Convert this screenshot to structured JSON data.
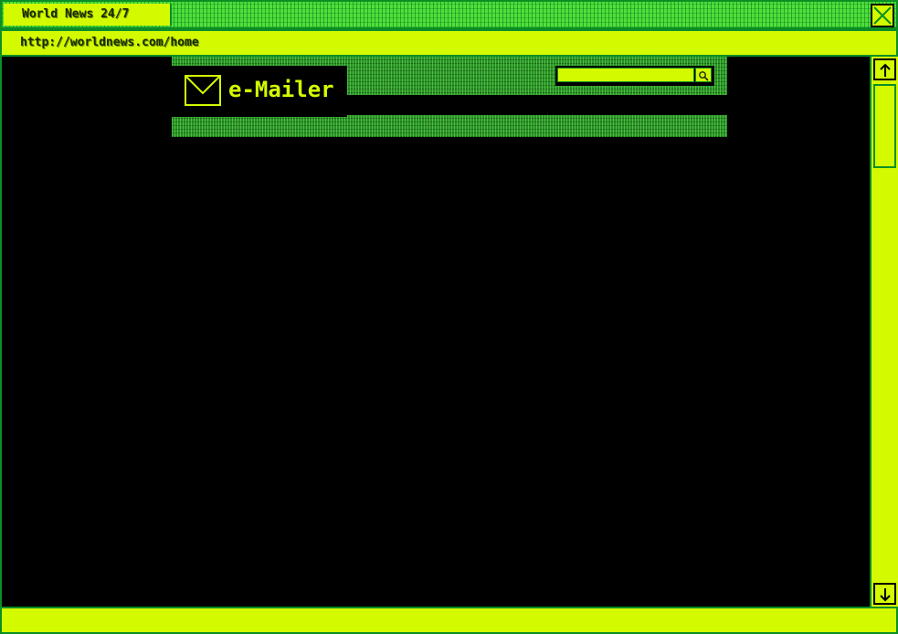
{
  "window": {
    "title": "World News 24/7",
    "close_icon": "close-x-icon"
  },
  "address_bar": {
    "url": "http://worldnews.com/home"
  },
  "site": {
    "logo_icon": "envelope-icon",
    "logo_text": "e-Mailer",
    "search": {
      "value": "",
      "placeholder": "",
      "button_icon": "search-icon"
    }
  },
  "scrollbar": {
    "up_icon": "arrow-up-icon",
    "down_icon": "arrow-down-icon"
  },
  "colors": {
    "accent": "#d4fa00",
    "border": "#0b8f24",
    "grid_green": "#4fe03a",
    "background": "#000000"
  }
}
